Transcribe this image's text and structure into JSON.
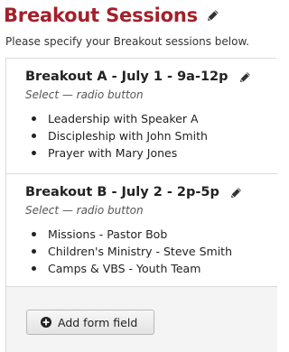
{
  "header": {
    "title": "Breakout Sessions",
    "subtitle": "Please specify your Breakout sessions below."
  },
  "fields": [
    {
      "title": "Breakout A - July 1 - 9a-12p",
      "type_label": "Select — radio button",
      "options": [
        "Leadership with Speaker A",
        "Discipleship with John Smith",
        "Prayer with Mary Jones"
      ]
    },
    {
      "title": "Breakout B - July 2 - 2p-5p",
      "type_label": "Select — radio button",
      "options": [
        "Missions - Pastor Bob",
        "Children's Ministry - Steve Smith",
        "Camps & VBS - Youth Team"
      ]
    }
  ],
  "footer": {
    "add_button_label": "Add form field"
  },
  "icons": {
    "edit": "pencil-icon",
    "add": "plus-circle-icon"
  },
  "colors": {
    "title": "#a3202a",
    "text": "#222222",
    "footer_background": "#f4f4f4"
  }
}
